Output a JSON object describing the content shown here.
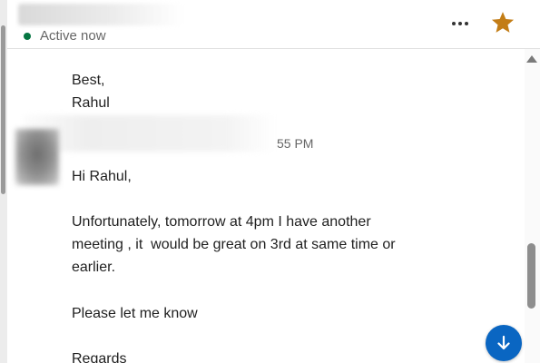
{
  "header": {
    "status_text": "Active now",
    "status_color": "#057642",
    "more_icon": "more-horizontal-icon",
    "star_icon": "star-icon",
    "star_color": "#c37d16"
  },
  "previous_message": {
    "lines": [
      "Best,",
      "Rahul"
    ]
  },
  "message": {
    "timestamp": "55 PM",
    "greeting": "Hi Rahul,",
    "body_lines": [
      "Unfortunately, tomorrow at 4pm I have another",
      "meeting , it  would be great on 3rd at same time or",
      "earlier."
    ],
    "request": "Please let me know",
    "closing": "Regards"
  },
  "controls": {
    "jump_icon": "arrow-down-icon",
    "jump_color": "#0a66c2",
    "scroll_up_icon": "scroll-up-icon"
  }
}
